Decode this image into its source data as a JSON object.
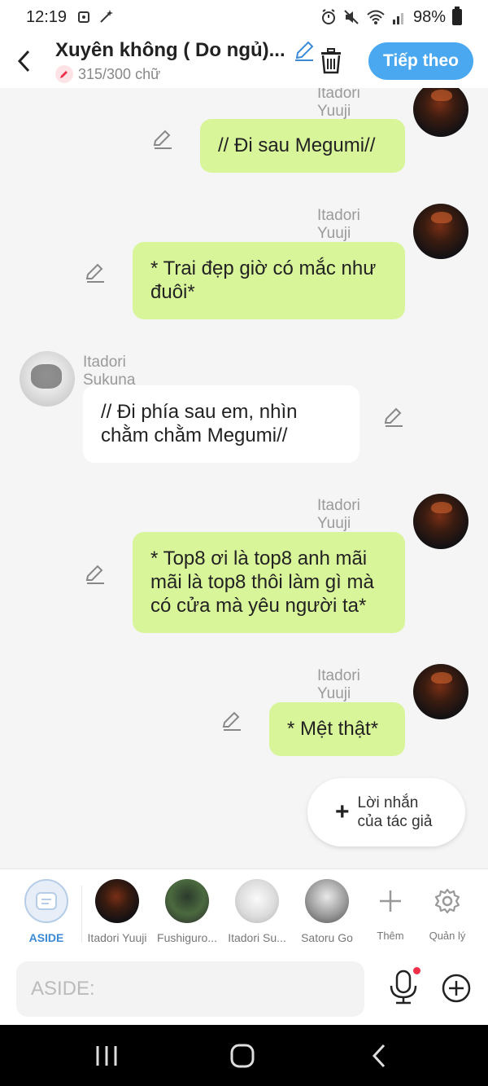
{
  "status": {
    "time": "12:19",
    "battery": "98%"
  },
  "header": {
    "title": "Xuyên không ( Do ngủ)...",
    "count": "315/300 chữ",
    "next_label": "Tiếp theo"
  },
  "messages": [
    {
      "speaker": "Itadori Yuuji",
      "text": "// Đi sau Megumi//",
      "side": "right"
    },
    {
      "speaker": "Itadori Yuuji",
      "text": "* Trai đẹp giờ có mắc như đuôi*",
      "side": "right"
    },
    {
      "speaker": "Itadori Sukuna",
      "text": "// Đi phía sau em, nhìn chằm chằm Megumi//",
      "side": "left"
    },
    {
      "speaker": "Itadori Yuuji",
      "text": "* Top8 ơi là top8 anh mãi mãi là top8 thôi làm gì mà có cửa mà yêu người ta*",
      "side": "right"
    },
    {
      "speaker": "Itadori Yuuji",
      "text": "* Mệt thật*",
      "side": "right"
    }
  ],
  "author_note": {
    "line1": "Lời nhắn",
    "line2": "của tác giả"
  },
  "characters": [
    {
      "label": "ASIDE"
    },
    {
      "label": "Itadori Yuuji"
    },
    {
      "label": "Fushiguro..."
    },
    {
      "label": "Itadori Su..."
    },
    {
      "label": "Satoru Go"
    }
  ],
  "tools": {
    "add_label": "Thêm",
    "manage_label": "Quản lý"
  },
  "input": {
    "placeholder": "ASIDE:"
  },
  "colors": {
    "bubble_green": "#d9f59a",
    "accent_blue": "#4aa8f0"
  }
}
